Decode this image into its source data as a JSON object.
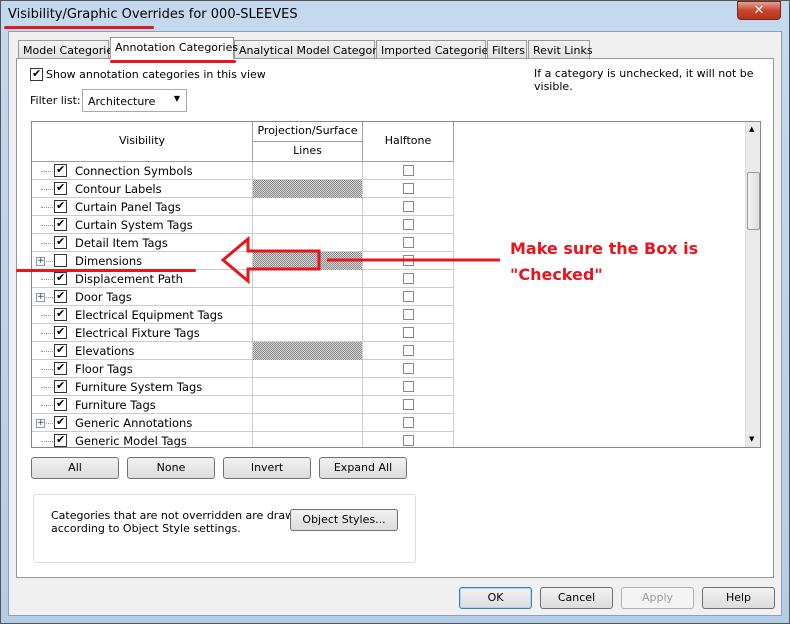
{
  "window": {
    "title": "Visibility/Graphic Overrides for 000-SLEEVES",
    "close_icon": "✕"
  },
  "tabs": [
    {
      "label": "Model Categories"
    },
    {
      "label": "Annotation Categories",
      "active": true
    },
    {
      "label": "Analytical Model Categories"
    },
    {
      "label": "Imported Categories"
    },
    {
      "label": "Filters"
    },
    {
      "label": "Revit Links"
    }
  ],
  "panel": {
    "show_label": "Show annotation categories in this view",
    "show_checked": true,
    "hint": "If a category is unchecked, it will not be visible.",
    "filter_label": "Filter list:",
    "filter_value": "Architecture"
  },
  "table": {
    "headers": {
      "visibility": "Visibility",
      "projection": "Projection/Surface",
      "lines": "Lines",
      "halftone": "Halftone"
    },
    "rows": [
      {
        "name": "Connection Symbols",
        "checked": true,
        "expand": false,
        "hatch": false
      },
      {
        "name": "Contour Labels",
        "checked": true,
        "expand": false,
        "hatch": true
      },
      {
        "name": "Curtain Panel Tags",
        "checked": true,
        "expand": false,
        "hatch": false
      },
      {
        "name": "Curtain System Tags",
        "checked": true,
        "expand": false,
        "hatch": false
      },
      {
        "name": "Detail Item Tags",
        "checked": true,
        "expand": false,
        "hatch": false
      },
      {
        "name": "Dimensions",
        "checked": false,
        "expand": true,
        "hatch": true
      },
      {
        "name": "Displacement Path",
        "checked": true,
        "expand": false,
        "hatch": false
      },
      {
        "name": "Door Tags",
        "checked": true,
        "expand": true,
        "hatch": false
      },
      {
        "name": "Electrical Equipment Tags",
        "checked": true,
        "expand": false,
        "hatch": false
      },
      {
        "name": "Electrical Fixture Tags",
        "checked": true,
        "expand": false,
        "hatch": false
      },
      {
        "name": "Elevations",
        "checked": true,
        "expand": false,
        "hatch": true
      },
      {
        "name": "Floor Tags",
        "checked": true,
        "expand": false,
        "hatch": false
      },
      {
        "name": "Furniture System Tags",
        "checked": true,
        "expand": false,
        "hatch": false
      },
      {
        "name": "Furniture Tags",
        "checked": true,
        "expand": false,
        "hatch": false
      },
      {
        "name": "Generic Annotations",
        "checked": true,
        "expand": true,
        "hatch": false
      },
      {
        "name": "Generic Model Tags",
        "checked": true,
        "expand": false,
        "hatch": false
      }
    ]
  },
  "actions": {
    "all": "All",
    "none": "None",
    "invert": "Invert",
    "expand_all": "Expand All"
  },
  "info": {
    "text1": "Categories that are not overridden are drawn",
    "text2": "according to Object Style settings.",
    "object_styles": "Object Styles..."
  },
  "footer": {
    "ok": "OK",
    "cancel": "Cancel",
    "apply": "Apply",
    "help": "Help"
  },
  "annotation": {
    "line1": "Make sure the Box is",
    "line2": "\"Checked\"",
    "color": "#e8141e"
  }
}
